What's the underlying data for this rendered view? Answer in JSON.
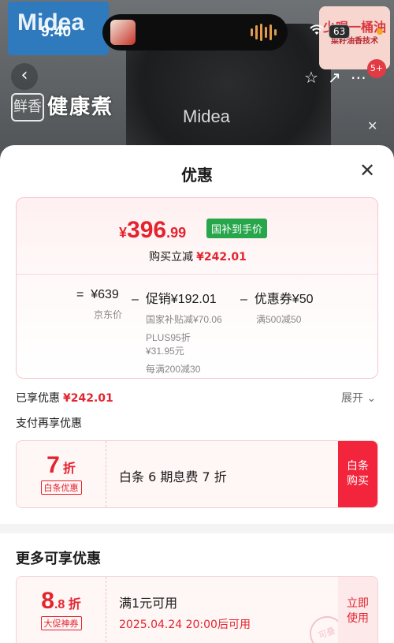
{
  "status_bar": {
    "time": "9:40",
    "battery": "63"
  },
  "background": {
    "brand_logo": "Midea",
    "pot_label": "Midea",
    "slogan_prefix": "鲜香",
    "slogan": "健康煮",
    "promo_top": "少喝一桶油",
    "promo_sub": "菜籽油香技术",
    "badge_count": "5+"
  },
  "sheet": {
    "title": "优惠",
    "price_card": {
      "currency": "¥",
      "price_int": "396",
      "price_dec": ".99",
      "tag": "国补到手价",
      "instant_label": "购买立减",
      "instant_value": "¥242.01",
      "breakdown": {
        "original_op": "=",
        "original_value": "¥639",
        "original_label": "京东价",
        "promo_op": "–",
        "promo_value": "促销¥192.01",
        "promo_details": [
          "国家补贴减¥70.06",
          "PLUS95折",
          "¥31.95元",
          "每满200减30"
        ],
        "coupon_op": "–",
        "coupon_value": "优惠券¥50",
        "coupon_detail": "满500减50"
      }
    },
    "enjoyed_label": "已享优惠",
    "enjoyed_value": "¥242.01",
    "expand_label": "展开",
    "pay_more_label": "支付再享优惠",
    "pay_coupon": {
      "discount_big": "7",
      "discount_unit": "折",
      "tag": "白条优惠",
      "text": "白条 6 期息费 7 折",
      "button_line1": "白条",
      "button_line2": "购买"
    },
    "more_title": "更多可享优惠",
    "more_coupon": {
      "discount_big": "8",
      "discount_small": ".8 折",
      "tag": "大促神券",
      "condition": "满1元可用",
      "time": "2025.04.24 20:00后可用",
      "button_line1": "立即",
      "button_line2": "使用",
      "stamp": "可叠"
    }
  },
  "colors": {
    "accent_red": "#e3242e",
    "button_red": "#f2253c",
    "tag_green": "#27a64b"
  }
}
